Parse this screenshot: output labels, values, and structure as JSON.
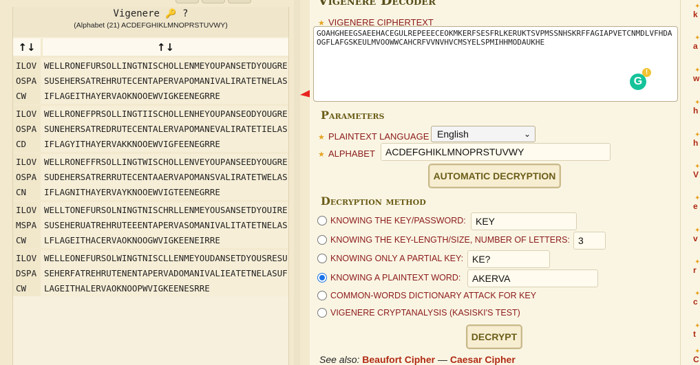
{
  "results": {
    "title": "Vigenere",
    "alphabet_note": "(Alphabet (21) ACDEFGHIKLMNOPRSTUVWY)",
    "sort_col1": "↑↓",
    "sort_col2": "↑↓",
    "rows": [
      {
        "key": "ILOVOSPACW",
        "text": "WELLRONEFURSOLLINGTNISCHOLLENMEYOUPANSETDYOUGRESUSEHERSATREHRUTECENTAPERVAPOMANIVALIRATETNELASIFLAGEITHAYERVAOKNOOEWVIGKEENEGRRE"
      },
      {
        "key": "ILOVOSPACD",
        "text": "WELLRONEFPRSOLLINGTIISCHOLLENHEYOUPANSEODYOUGRESUNEHERSATREDRUTECENTALERVAPOMANEVALIRATETIELASIFLAGYITHAYERVAKKNOOEWVIGFEENEGRRE"
      },
      {
        "key": "ILOVOSPACN",
        "text": "WELLRONEFFRSOLLINGTWISCHOLLENVEYOUPANSEEDYOUGRESUDEHERSATRERRUTECENTAAERVAPOMANSVALIRATETWELASIFLAGNITHAYERVAYKNOOEWVIGTEENEGRRE"
      },
      {
        "key": "ILOVMSPACW",
        "text": "WELLTONEFURSOLNINGTNISCHRLLENMEYOUSANSETDYOUIRESUSEHERUATREHRUTEEENTAPERVASOMANIVALITATETNELASLFLAGEITHACERVAOKNOOGWVIGKEENEIRRE"
      },
      {
        "key": "ILOVDSPACW",
        "text": "WELLEONEFURSOLWINGTNISCLLENMEYOUDANSETDYOUSRESUSEHERFATREHRUTENENTAPERVADOMANIVALIEATETNELASUFLAGEITHALERVAOKNOOPWVIGKEENESRRE"
      }
    ]
  },
  "decoder": {
    "title": "Vigenere Decoder",
    "ciphertext_label": "VIGENERE CIPHERTEXT",
    "ciphertext": "GOAHGHEEGSAEEHACEGULREPEEECEOKMKERFSESFRLKERUKTSVPMSSNHSKRFFAGIAPVETCNMDLVFHDAOGFLAFGSKEULMVOOWWCAHCRFVVNVHVCMSYELSPMIHHMODAUKHE"
  },
  "parameters": {
    "title": "Parameters",
    "lang_label": "PLAINTEXT LANGUAGE",
    "lang_value": "English",
    "alphabet_label": "ALPHABET",
    "alphabet_value": "ACDEFGHIKLMNOPRSTUVWY",
    "auto_button": "AUTOMATIC DECRYPTION"
  },
  "method": {
    "title": "Decryption method",
    "opt_key": "KNOWING THE KEY/PASSWORD:",
    "key_value": "KEY",
    "opt_len": "KNOWING THE KEY-LENGTH/SIZE, NUMBER OF LETTERS:",
    "len_value": "3",
    "opt_partial": "KNOWING ONLY A PARTIAL KEY:",
    "partial_value": "KE?",
    "opt_word": "KNOWING A PLAINTEXT WORD:",
    "word_value": "AKERVA",
    "opt_dict": "COMMON-WORDS DICTIONARY ATTACK FOR KEY",
    "opt_kasiski": "VIGENERE CRYPTANALYSIS (KASISKI'S TEST)",
    "decrypt_button": "DECRYPT"
  },
  "see_also": {
    "prefix": "See also:",
    "link1": "Beaufort Cipher",
    "sep": "—",
    "link2": "Caesar Cipher"
  },
  "sidebar": {
    "letters": [
      "k",
      "a",
      "w",
      "h",
      "h",
      "V",
      "e",
      "v",
      "r",
      "c",
      "t",
      "C"
    ]
  },
  "colors": {
    "accent": "#6b5d18",
    "link": "#b02a13",
    "arrow": "#e8231f",
    "radio": "#1a73e8"
  }
}
